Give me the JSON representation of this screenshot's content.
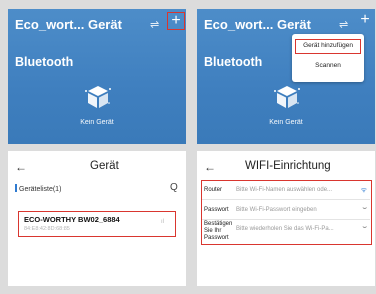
{
  "screen1": {
    "title": "Eco_wort... Gerät",
    "section": "Bluetooth",
    "empty_label": "Kein Gerät",
    "tune_icon": "sliders-icon",
    "plus_icon": "+"
  },
  "screen2": {
    "title": "Eco_wort... Gerät",
    "section": "Bluetooth",
    "empty_label": "Kein Gerät",
    "plus_icon": "+",
    "menu": {
      "add_device": "Gerät hinzufügen",
      "scan": "Scannen"
    }
  },
  "screen3": {
    "back": "←",
    "title": "Gerät",
    "list_header": "Geräteliste(1)",
    "refresh_icon": "Q",
    "device": {
      "name": "ECO-WORTHY BW02_6884",
      "mac": "84:E8:42:8D:68:85",
      "signal": "ıl"
    }
  },
  "screen4": {
    "back": "←",
    "title": "WIFI-Einrichtung",
    "fields": [
      {
        "label": "Router",
        "placeholder": "Bitte Wi-Fi-Namen auswählen ode...",
        "icon": "ᯤ"
      },
      {
        "label": "Passwort",
        "placeholder": "Bitte Wi-Fi-Passwort eingeben",
        "icon": "⌣"
      },
      {
        "label_lines": [
          "Bestätigen",
          "Sie Ihr",
          "Passwort"
        ],
        "placeholder": "Bitte wiederholen Sie das Wi-Fi-Pa...",
        "icon": "⌣"
      }
    ]
  },
  "colors": {
    "header_blue": "#4d8dc9",
    "highlight_red": "#d9362f",
    "accent_blue": "#2f7bd1"
  }
}
